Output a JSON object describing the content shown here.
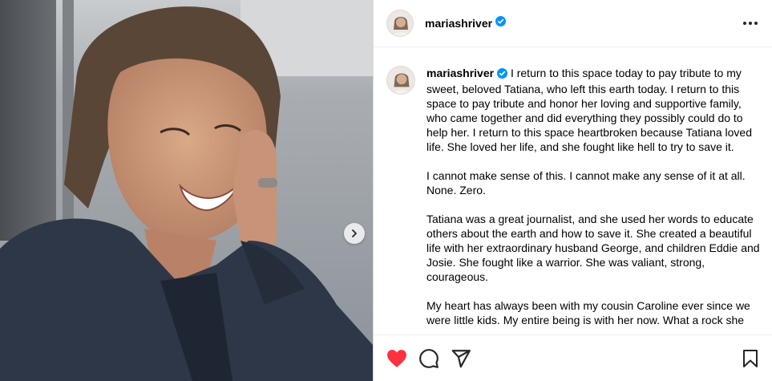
{
  "post": {
    "username": "mariashriver",
    "verified": true,
    "caption_paragraphs": [
      "I return to this space today to pay tribute to my sweet, beloved Tatiana, who left this earth today. I return to this space to pay tribute and honor her loving and supportive family, who came together and did everything they possibly could do to help her. I return to this space heartbroken because Tatiana loved life. She loved her life, and she fought like hell to try to save it.",
      "I cannot make sense of this. I cannot make any sense of it at all. None. Zero.",
      "Tatiana was a great journalist, and she used her words to educate others about the earth and how to save it. She created a beautiful life with her extraordinary husband George, and children Eddie and Josie. She fought like a warrior. She was valiant, strong, courageous.",
      "My heart has always been with my cousin Caroline ever since we were little kids. My entire being is with her now. What a rock she"
    ]
  },
  "icons": {
    "verified": "verified-badge-icon",
    "more": "more-options-icon",
    "next": "chevron-right-icon",
    "like": "heart-icon",
    "comment": "comment-icon",
    "share": "share-icon",
    "save": "bookmark-icon"
  },
  "colors": {
    "like": "#ff3040",
    "verified": "#0095f6",
    "border": "#dbdbdb"
  }
}
